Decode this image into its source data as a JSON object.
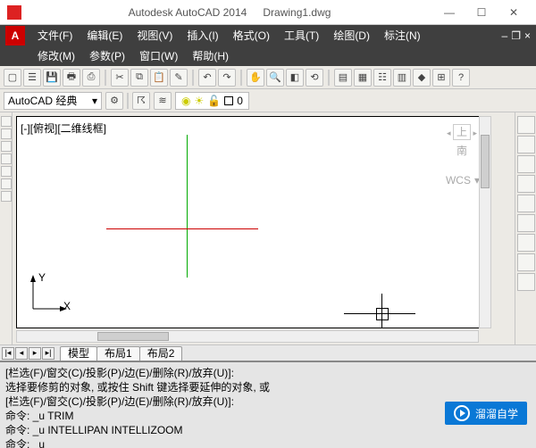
{
  "title": {
    "app": "Autodesk AutoCAD 2014",
    "doc": "Drawing1.dwg"
  },
  "winbtns": {
    "min": "—",
    "max": "☐",
    "close": "✕"
  },
  "menu1": [
    "文件(F)",
    "编辑(E)",
    "视图(V)",
    "插入(I)",
    "格式(O)",
    "工具(T)",
    "绘图(D)",
    "标注(N)"
  ],
  "menu2": [
    "修改(M)",
    "参数(P)",
    "窗口(W)",
    "帮助(H)"
  ],
  "mdi": {
    "min": "‒",
    "restore": "❐",
    "close": "×"
  },
  "workspace": {
    "label": "AutoCAD 经典"
  },
  "layer": {
    "name": "0"
  },
  "viewport": {
    "label": "[-][俯视][二维线框]"
  },
  "viewcube": {
    "face": "上",
    "south": "南",
    "arrow": "▾"
  },
  "wcs": {
    "label": "WCS",
    "arrow": "▾"
  },
  "ucs": {
    "x": "X",
    "y": "Y"
  },
  "tabs": {
    "nav": [
      "|◂",
      "◂",
      "▸",
      "▸|"
    ],
    "items": [
      "模型",
      "布局1",
      "布局2"
    ]
  },
  "cmd": {
    "l1": "[栏选(F)/窗交(C)/投影(P)/边(E)/删除(R)/放弃(U)]:",
    "l2": "选择要修剪的对象, 或按住 Shift 键选择要延伸的对象, 或",
    "l3": "[栏选(F)/窗交(C)/投影(P)/边(E)/删除(R)/放弃(U)]:",
    "l4": "命令: _u TRIM",
    "l5": "命令: _u INTELLIPAN INTELLIZOOM",
    "l6": "命令: _u"
  },
  "watermark": {
    "text": "溜溜自学"
  }
}
